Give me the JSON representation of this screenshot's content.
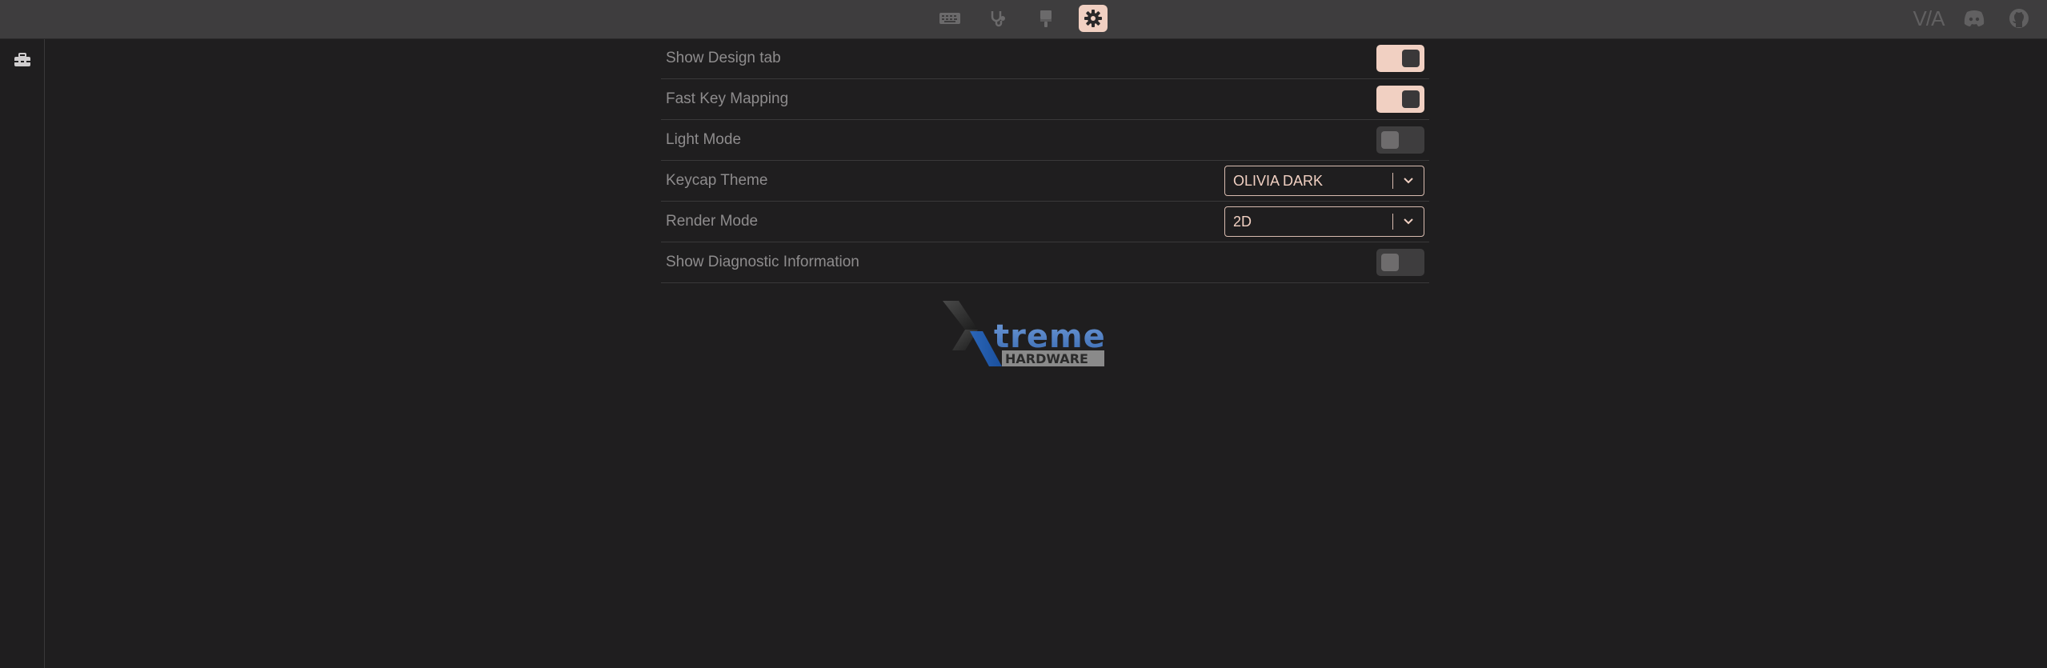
{
  "topbar": {
    "tabs": [
      {
        "name": "keyboard-icon",
        "active": false
      },
      {
        "name": "stethoscope-icon",
        "active": false
      },
      {
        "name": "paintbrush-icon",
        "active": false
      },
      {
        "name": "gear-icon",
        "active": true
      }
    ],
    "via_logo": "V/A",
    "right_icons": [
      "discord-icon",
      "github-icon"
    ]
  },
  "sidebar": {
    "icon": "toolbox-icon"
  },
  "settings": {
    "rows": [
      {
        "label": "Show Design tab",
        "control": "toggle",
        "value": true
      },
      {
        "label": "Fast Key Mapping",
        "control": "toggle",
        "value": true
      },
      {
        "label": "Light Mode",
        "control": "toggle",
        "value": false
      },
      {
        "label": "Keycap Theme",
        "control": "select",
        "value": "OLIVIA DARK"
      },
      {
        "label": "Render Mode",
        "control": "select",
        "value": "2D"
      },
      {
        "label": "Show Diagnostic Information",
        "control": "toggle",
        "value": false
      }
    ]
  },
  "logo": {
    "word_main": "treme",
    "word_sub": "HARDWARE"
  },
  "colors": {
    "accent": "#f1d0c2",
    "background": "#1f1e1f",
    "topbar": "#3e3d3e",
    "label": "#8e8c8d"
  }
}
